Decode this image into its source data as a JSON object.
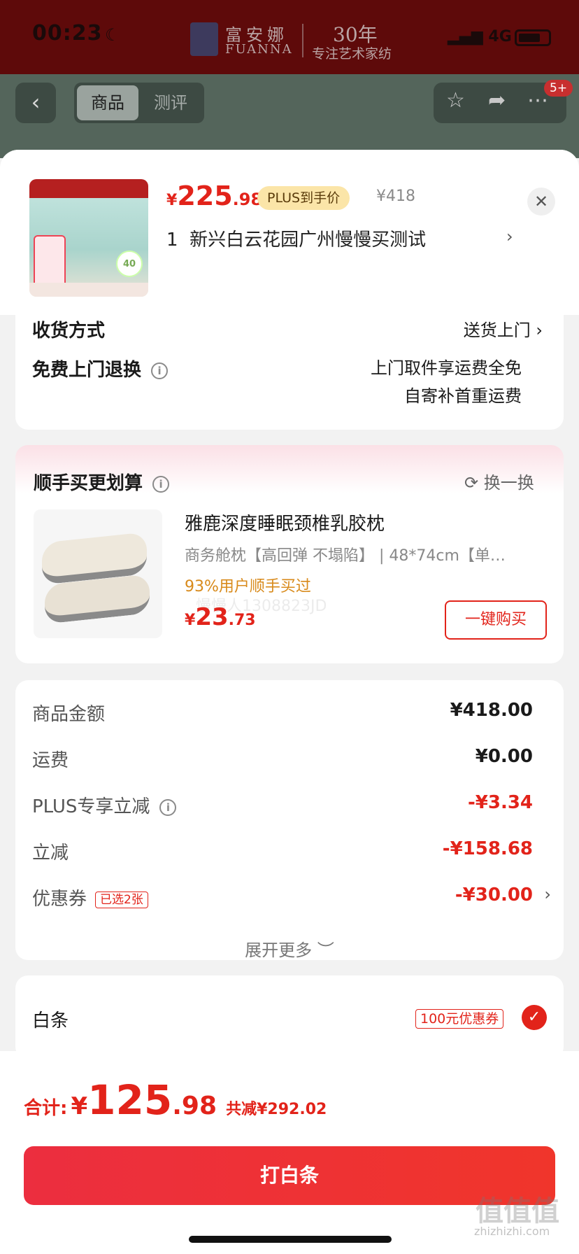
{
  "status_bar": {
    "time": "00:23",
    "network": "4G"
  },
  "brand": {
    "name_cn": "富安娜",
    "name_en": "FUANNA",
    "years": "30年",
    "slogan": "专注艺术家纺"
  },
  "nav": {
    "tabs": [
      "商品",
      "测评"
    ],
    "badge": "5+"
  },
  "product": {
    "price_yen": "¥",
    "price_int": "225",
    "price_dec": ".98",
    "plus_label": "PLUS到手价",
    "original_price": "¥418",
    "quantity": "1",
    "address": "新兴白云花园广州慢慢买测试"
  },
  "delivery": {
    "method_label": "收货方式",
    "method_value": "送货上门",
    "return_label": "免费上门退换",
    "return_line1": "上门取件享运费全免",
    "return_line2": "自寄补首重运费"
  },
  "recommend": {
    "title": "顺手买更划算",
    "refresh": "换一换",
    "name": "雅鹿深度睡眠颈椎乳胶枕",
    "spec": "商务舱枕【高回弹 不塌陷】 | 48*74cm【单…",
    "stat": "93%用户顺手买过",
    "price_yen": "¥",
    "price_int": "23",
    "price_dec": ".73",
    "buy": "一键购买",
    "watermark": "慢慢人1308823JD"
  },
  "breakdown": {
    "rows": [
      {
        "label": "商品金额",
        "value": "¥418.00"
      },
      {
        "label": "运费",
        "value": "¥0.00"
      },
      {
        "label": "PLUS专享立减",
        "value": "-¥3.34"
      },
      {
        "label": "立减",
        "value": "-¥158.68"
      },
      {
        "label": "优惠券",
        "tag": "已选2张",
        "value": "-¥30.00"
      }
    ],
    "expand": "展开更多 ︶"
  },
  "payment": {
    "method": "白条",
    "coupon": "100元优惠券"
  },
  "total": {
    "label": "合计:",
    "yen": "¥",
    "int": "125",
    "dec": ".98",
    "save": "共减¥292.02"
  },
  "pay_button": "打白条",
  "watermark_site": {
    "cn": "值值值",
    "en": "zhizhizhi.com"
  }
}
